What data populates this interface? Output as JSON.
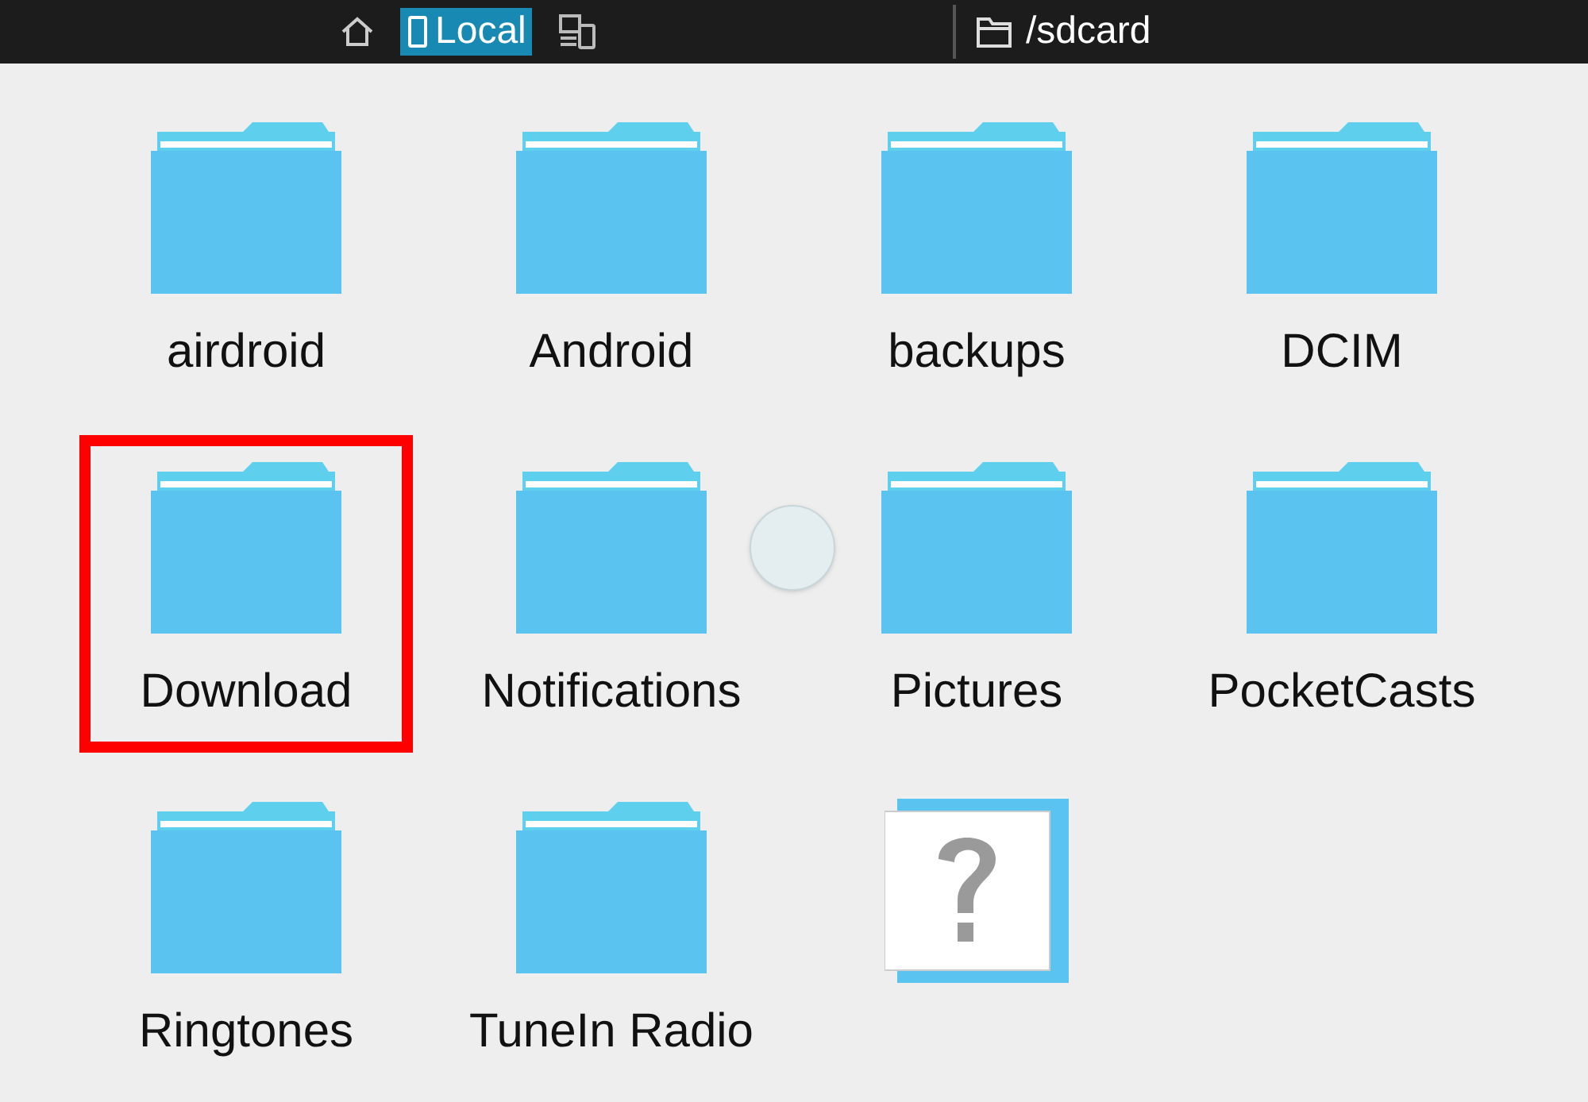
{
  "toolbar": {
    "tabs": [
      {
        "kind": "home",
        "selected": false
      },
      {
        "kind": "local",
        "label": "Local",
        "selected": true
      },
      {
        "kind": "devices",
        "selected": false
      }
    ],
    "path": "/sdcard"
  },
  "items": [
    {
      "kind": "folder",
      "name": "airdroid",
      "highlighted": false
    },
    {
      "kind": "folder",
      "name": "Android",
      "highlighted": false
    },
    {
      "kind": "folder",
      "name": "backups",
      "highlighted": false
    },
    {
      "kind": "folder",
      "name": "DCIM",
      "highlighted": false
    },
    {
      "kind": "folder",
      "name": "Download",
      "highlighted": true
    },
    {
      "kind": "folder",
      "name": "Notifications",
      "highlighted": false
    },
    {
      "kind": "folder",
      "name": "Pictures",
      "highlighted": false
    },
    {
      "kind": "folder",
      "name": "PocketCasts",
      "highlighted": false
    },
    {
      "kind": "folder",
      "name": "Ringtones",
      "highlighted": false
    },
    {
      "kind": "folder",
      "name": "TuneIn Radio",
      "highlighted": false
    },
    {
      "kind": "unknown",
      "highlighted": false
    }
  ]
}
